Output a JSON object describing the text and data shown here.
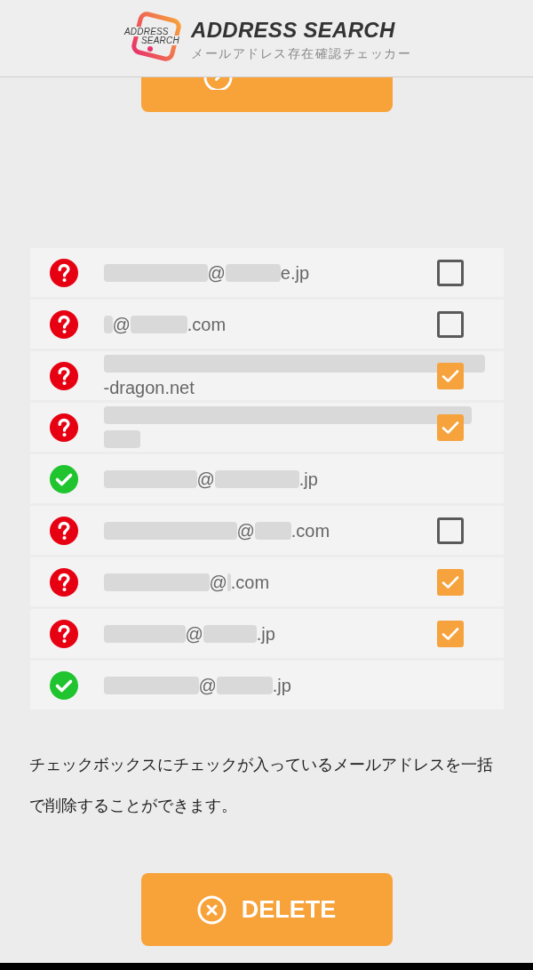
{
  "header": {
    "logo_text": [
      "ADDRESS",
      "SEARCH"
    ],
    "title": "ADDRESS SEARCH",
    "subtitle": "メールアドレス存在確認チェッカー"
  },
  "rows": [
    {
      "kind": "unknown",
      "checked": false,
      "address_lines": [
        [
          {
            "kind": "redacted"
          },
          {
            "kind": "text",
            "text": "@"
          },
          {
            "kind": "redacted"
          },
          {
            "kind": "text",
            "text": "e.jp"
          }
        ]
      ]
    },
    {
      "kind": "unknown",
      "checked": false,
      "address_lines": [
        [
          {
            "kind": "redacted"
          },
          {
            "kind": "text",
            "text": "@"
          },
          {
            "kind": "redacted"
          },
          {
            "kind": "text",
            "text": ".com"
          }
        ]
      ]
    },
    {
      "kind": "unknown",
      "checked": true,
      "address_lines": [
        [
          {
            "kind": "redacted"
          }
        ],
        [
          {
            "kind": "text",
            "text": "-dragon.net"
          }
        ]
      ]
    },
    {
      "kind": "unknown",
      "checked": true,
      "address_lines": [
        [
          {
            "kind": "redacted"
          }
        ],
        [
          {
            "kind": "redacted"
          }
        ]
      ]
    },
    {
      "kind": "valid",
      "address_lines": [
        [
          {
            "kind": "redacted"
          },
          {
            "kind": "text",
            "text": "@"
          },
          {
            "kind": "redacted"
          },
          {
            "kind": "text",
            "text": ".jp"
          }
        ]
      ]
    },
    {
      "kind": "unknown",
      "checked": false,
      "address_lines": [
        [
          {
            "kind": "redacted"
          },
          {
            "kind": "text",
            "text": "@"
          },
          {
            "kind": "redacted"
          },
          {
            "kind": "text",
            "text": ".com"
          }
        ]
      ]
    },
    {
      "kind": "unknown",
      "checked": true,
      "address_lines": [
        [
          {
            "kind": "redacted"
          },
          {
            "kind": "text",
            "text": "@"
          },
          {
            "kind": "redacted"
          },
          {
            "kind": "text",
            "text": ".com"
          }
        ]
      ]
    },
    {
      "kind": "unknown",
      "checked": true,
      "address_lines": [
        [
          {
            "kind": "redacted"
          },
          {
            "kind": "text",
            "text": "@"
          },
          {
            "kind": "redacted"
          },
          {
            "kind": "text",
            "text": ".jp"
          }
        ]
      ]
    },
    {
      "kind": "valid",
      "address_lines": [
        [
          {
            "kind": "redacted"
          },
          {
            "kind": "text",
            "text": "@"
          },
          {
            "kind": "redacted"
          },
          {
            "kind": "text",
            "text": ".jp"
          }
        ]
      ]
    }
  ],
  "note": "チェックボックスにチェックが入っているメールアドレスを一括で削除することができます。",
  "delete_button": {
    "label": "DELETE"
  }
}
